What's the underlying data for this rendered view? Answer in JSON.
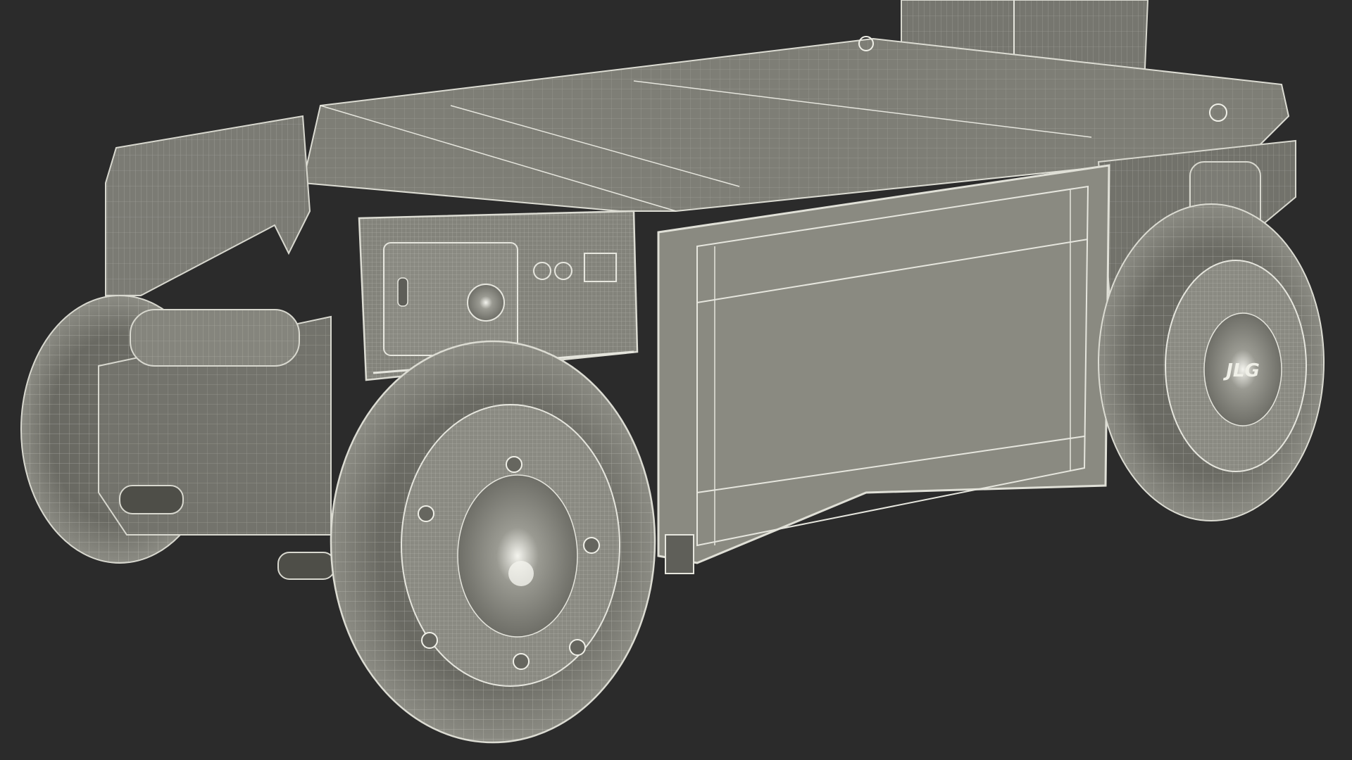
{
  "scene": {
    "subject": "",
    "background_color": "#2b2b2b",
    "body_color": "#7a7a72",
    "wire_color": "#d8d8cf",
    "shadow_color": "#5e5e58",
    "hub_logo_text": "JLG"
  }
}
